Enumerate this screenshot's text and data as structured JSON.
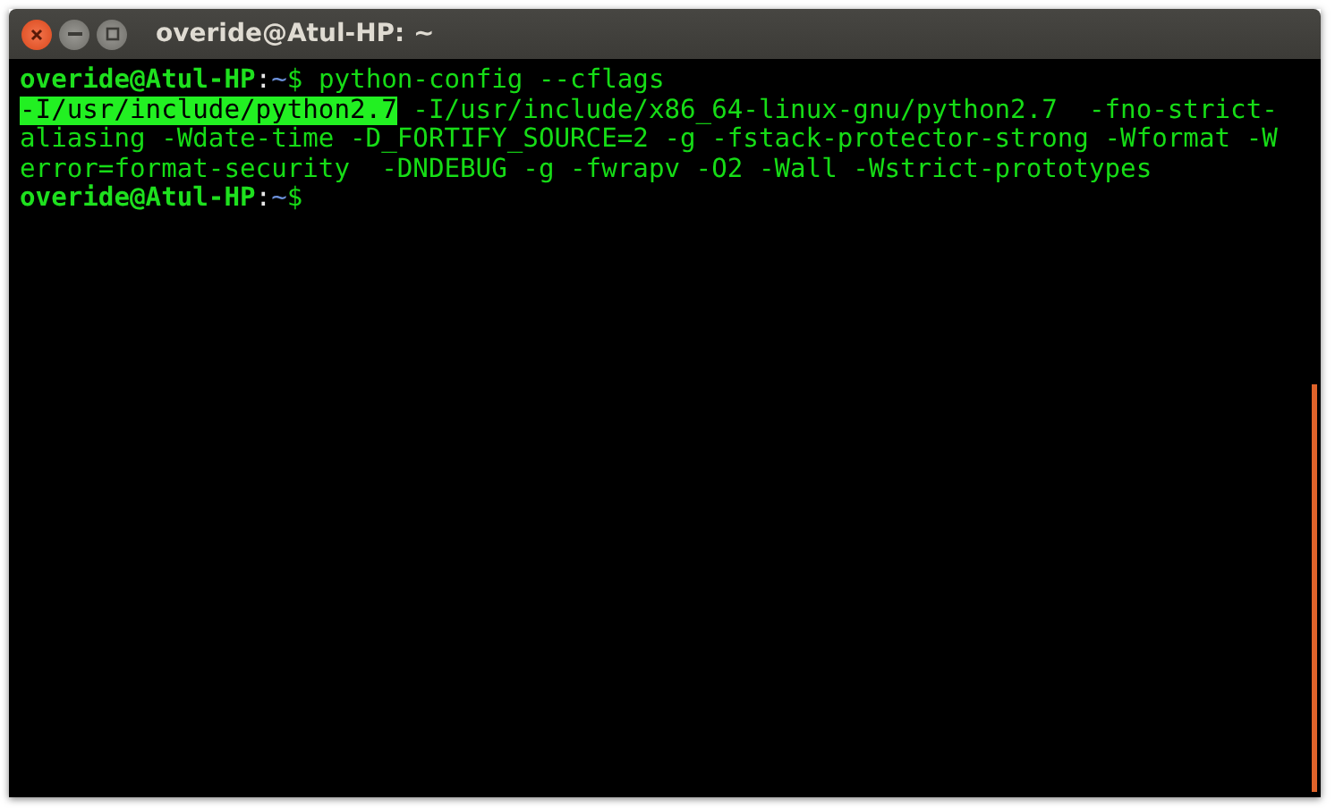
{
  "window": {
    "title": "overide@Atul-HP: ~"
  },
  "terminal": {
    "lines": [
      {
        "kind": "prompt",
        "user": "overide@Atul-HP",
        "separator": ":",
        "path": "~",
        "command": "$ python-config --cflags"
      },
      {
        "kind": "output",
        "segments": [
          {
            "text": "-I/usr/include/python2.7",
            "selected": true
          },
          {
            "text": " -I/usr/include/x86_64-linux-gnu/python2.7  -fno-strict-",
            "selected": false
          }
        ]
      },
      {
        "kind": "output",
        "segments": [
          {
            "text": "aliasing -Wdate-time -D_FORTIFY_SOURCE=2 -g -fstack-protector-strong -Wformat -W",
            "selected": false
          }
        ]
      },
      {
        "kind": "output",
        "segments": [
          {
            "text": "error=format-security  -DNDEBUG -g -fwrapv -O2 -Wall -Wstrict-prototypes",
            "selected": false
          }
        ]
      },
      {
        "kind": "prompt",
        "user": "overide@Atul-HP",
        "separator": ":",
        "path": "~",
        "command": "$"
      }
    ]
  }
}
